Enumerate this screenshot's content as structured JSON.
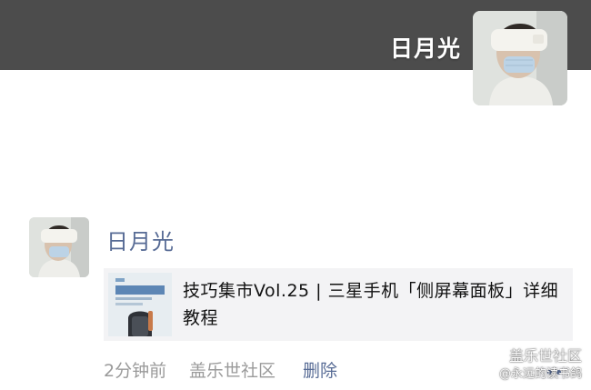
{
  "cover": {
    "name": "日月光"
  },
  "post": {
    "author": "日月光",
    "link_title": "技巧集市Vol.25 | 三星手机「侧屏幕面板」详细教程",
    "time": "2分钟前",
    "source": "盖乐世社区",
    "delete_label": "删除"
  },
  "watermark": {
    "line1": "盖乐世社区",
    "line2": "@永远的读书鸽"
  },
  "colors": {
    "cover_bg": "#4c4c4c",
    "link_blue": "#576b95",
    "card_bg": "#f3f3f5",
    "meta_gray": "#9a9a9a"
  },
  "icons": {
    "more": "more-dots-icon"
  }
}
